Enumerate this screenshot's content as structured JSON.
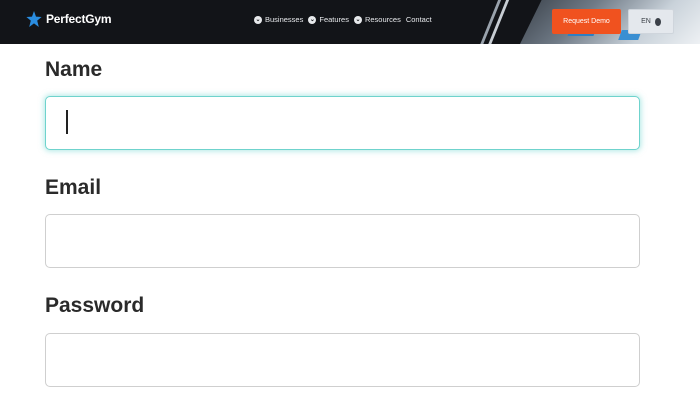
{
  "header": {
    "brand": "PerfectGym",
    "nav": [
      {
        "label": "Businesses",
        "icon": "chevron-down-icon"
      },
      {
        "label": "Features",
        "icon": "chevron-down-icon"
      },
      {
        "label": "Resources",
        "icon": "chevron-down-icon"
      },
      {
        "label": "Contact"
      }
    ],
    "request_demo_label": "Request Demo",
    "language_label": "EN",
    "colors": {
      "bar": "#121418",
      "accent": "#f0521f"
    }
  },
  "form": {
    "fields": [
      {
        "label": "Name",
        "value": "",
        "focused": true
      },
      {
        "label": "Email",
        "value": ""
      },
      {
        "label": "Password",
        "value": ""
      }
    ],
    "focus_color": "#6fd3cd"
  }
}
